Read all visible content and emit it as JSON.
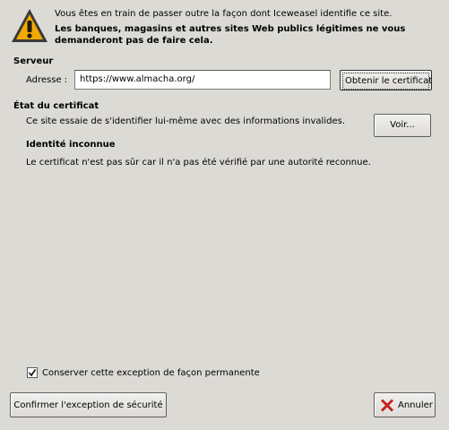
{
  "warning": {
    "line1": "Vous êtes en train de passer outre la façon dont Iceweasel identifie ce site.",
    "bold": "Les banques, magasins et autres sites Web publics légitimes ne vous demanderont pas de faire cela."
  },
  "server": {
    "title": "Serveur",
    "address_label": "Adresse :",
    "address_value": "https://www.almacha.org/",
    "get_certificate_label": "Obtenir le certificat"
  },
  "certificate_status": {
    "title": "État du certificat",
    "status_text": "Ce site essaie de s'identifier lui-même avec des informations invalides.",
    "view_label": "Voir...",
    "identity_title": "Identité inconnue",
    "identity_text": "Le certificat n'est pas sûr car il n'a pas été vérifié par une autorité reconnue."
  },
  "permanent": {
    "label": "Conserver cette exception de façon permanente",
    "checked": true
  },
  "buttons": {
    "confirm": "Confirmer l'exception de sécurité",
    "cancel": "Annuler"
  },
  "icons": {
    "warning": "warning-triangle-icon",
    "cancel": "cancel-x-icon",
    "check": "checkmark-icon"
  },
  "colors": {
    "background": "#dcdad5",
    "warning_fill": "#f2a900",
    "cancel_x": "#e02020"
  }
}
